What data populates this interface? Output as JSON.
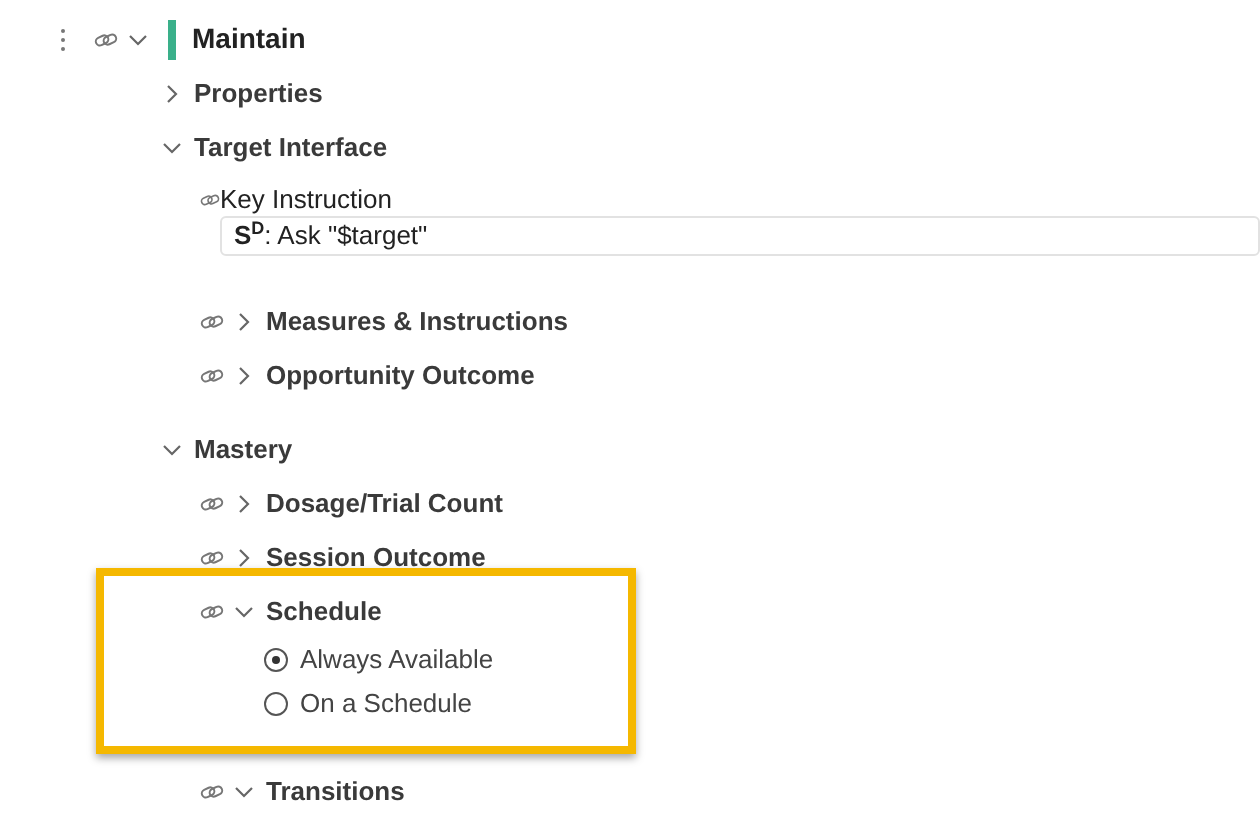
{
  "tree": [
    {
      "kind": "section",
      "title": "Maintain",
      "linked": true,
      "expanded": true,
      "children": [
        {
          "kind": "section",
          "title": "Properties",
          "linked": false,
          "expanded": false
        },
        {
          "kind": "section",
          "title": "Target Interface",
          "linked": false,
          "expanded": true,
          "children": [
            {
              "kind": "field",
              "title": "Key Instruction",
              "linked": true,
              "value": "**S**$^{D}$: Ask \"$target\""
            },
            {
              "kind": "section",
              "title": "Measures & Instructions",
              "linked": true,
              "expanded": false
            },
            {
              "kind": "section",
              "title": "Opportunity Outcome",
              "linked": true,
              "expanded": false
            }
          ]
        },
        {
          "kind": "section",
          "title": "Mastery",
          "linked": false,
          "expanded": true,
          "children": [
            {
              "kind": "section",
              "title": "Dosage/Trial Count",
              "linked": true,
              "expanded": false
            },
            {
              "kind": "section",
              "title": "Session Outcome",
              "linked": true,
              "expanded": false
            },
            {
              "kind": "section",
              "title": "Schedule",
              "linked": true,
              "expanded": true,
              "highlighted": true,
              "children": [
                {
                  "kind": "radio",
                  "label": "Always Available",
                  "selected": true
                },
                {
                  "kind": "radio",
                  "label": "On a Schedule",
                  "selected": false
                }
              ]
            },
            {
              "kind": "section",
              "title": "Transitions",
              "linked": true,
              "expanded": true
            }
          ]
        }
      ]
    }
  ]
}
